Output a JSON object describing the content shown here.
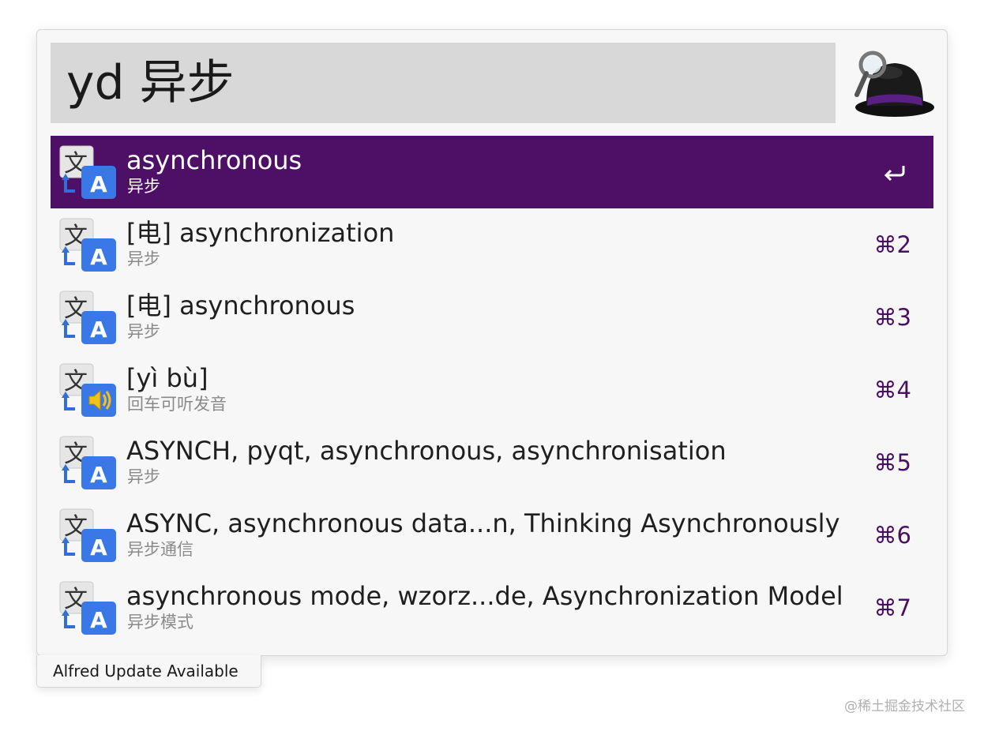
{
  "search": {
    "query": "yd 异步"
  },
  "results": [
    {
      "title": "asynchronous",
      "subtitle": "异步",
      "shortcut": "",
      "icon": "translate-icon",
      "selected": true
    },
    {
      "title": "[电] asynchronization",
      "subtitle": "异步",
      "shortcut": "⌘2",
      "icon": "translate-icon",
      "selected": false
    },
    {
      "title": "[电] asynchronous",
      "subtitle": "异步",
      "shortcut": "⌘3",
      "icon": "translate-icon",
      "selected": false
    },
    {
      "title": "[yì bù]",
      "subtitle": "回车可听发音",
      "shortcut": "⌘4",
      "icon": "pronounce-icon",
      "selected": false
    },
    {
      "title": "ASYNCH, pyqt, asynchronous, asynchronisation",
      "subtitle": "异步",
      "shortcut": "⌘5",
      "icon": "translate-icon",
      "selected": false
    },
    {
      "title": "ASYNC, asynchronous data...n, Thinking Asynchronously",
      "subtitle": "异步通信",
      "shortcut": "⌘6",
      "icon": "translate-icon",
      "selected": false
    },
    {
      "title": "asynchronous mode, wzorz...de, Asynchronization Model",
      "subtitle": "异步模式",
      "shortcut": "⌘7",
      "icon": "translate-icon",
      "selected": false
    }
  ],
  "update_notice": "Alfred Update Available",
  "watermark": "@稀土掘金技术社区",
  "colors": {
    "selection": "#4d1066",
    "shortcut": "#4a0e63",
    "search_bg": "#d8d8d8",
    "window_bg": "#f7f7f8"
  }
}
